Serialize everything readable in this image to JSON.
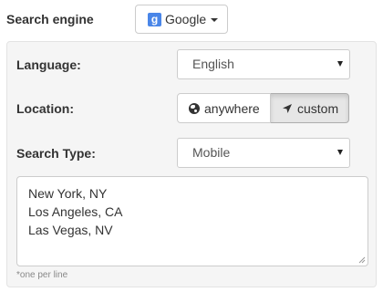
{
  "search_engine": {
    "label": "Search engine",
    "selected": "Google",
    "icon_letter": "g"
  },
  "language": {
    "label": "Language:",
    "value": "English"
  },
  "location": {
    "label": "Location:",
    "options": [
      "anywhere",
      "custom"
    ],
    "selected": "custom"
  },
  "search_type": {
    "label": "Search Type:",
    "value": "Mobile"
  },
  "locations_textarea": {
    "lines": [
      "New York, NY",
      "Los Angeles, CA",
      "Las Vegas, NV"
    ],
    "hint": "*one per line"
  },
  "colors": {
    "google_icon": "#4a86e8",
    "panel_bg": "#f5f5f5",
    "active_segment_bg": "#e6e6e6"
  }
}
